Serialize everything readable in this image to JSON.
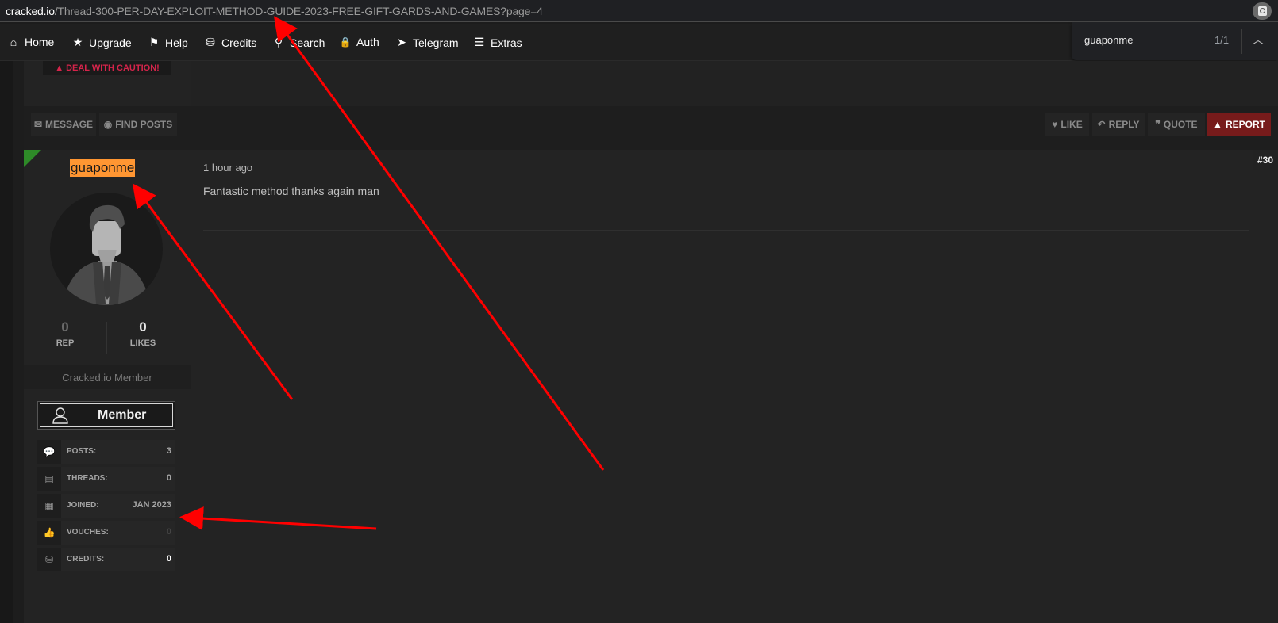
{
  "browser": {
    "url_host": "cracked.io",
    "url_path": "/Thread-300-PER-DAY-EXPLOIT-METHOD-GUIDE-2023-FREE-GIFT-GARDS-AND-GAMES?page=4",
    "lens_icon": "google-lens-icon"
  },
  "find_bar": {
    "query": "guaponme",
    "match_count": "1/1",
    "prev_icon": "chevron-up-icon"
  },
  "nav": {
    "items": [
      {
        "label": "Home",
        "icon": "home-icon",
        "glyph": "⌂"
      },
      {
        "label": "Upgrade",
        "icon": "star-icon",
        "glyph": "★"
      },
      {
        "label": "Help",
        "icon": "flag-icon",
        "glyph": "⚑"
      },
      {
        "label": "Credits",
        "icon": "coins-icon",
        "glyph": "⛁"
      },
      {
        "label": "Search",
        "icon": "search-icon",
        "glyph": "⚲"
      },
      {
        "label": "Auth",
        "icon": "lock-icon",
        "glyph": "🔒"
      },
      {
        "label": "Telegram",
        "icon": "telegram-icon",
        "glyph": "➤"
      },
      {
        "label": "Extras",
        "icon": "bars-icon",
        "glyph": "☰"
      }
    ]
  },
  "prev_post": {
    "caution_label": "DEAL WITH CAUTION!",
    "caution_color": "#d6244b"
  },
  "actions": {
    "message": "MESSAGE",
    "find_posts": "FIND POSTS",
    "like": "LIKE",
    "reply": "REPLY",
    "quote": "QUOTE",
    "report": "REPORT",
    "report_color": "#771b1b"
  },
  "post": {
    "username": "guaponme",
    "username_highlight": "#ff9632",
    "online_color": "#2e8a28",
    "rep_value": "0",
    "rep_label": "REP",
    "likes_value": "0",
    "likes_label": "LIKES",
    "usergroup": "Cracked.io Member",
    "badge_label": "Member",
    "info": [
      {
        "key": "POSTS:",
        "value": "3",
        "icon": "comments-icon",
        "glyph": "💬"
      },
      {
        "key": "THREADS:",
        "value": "0",
        "icon": "book-icon",
        "glyph": "▤"
      },
      {
        "key": "JOINED:",
        "value": "JAN 2023",
        "icon": "calendar-icon",
        "glyph": "▦"
      },
      {
        "key": "VOUCHES:",
        "value": "0",
        "icon": "thumbs-up-icon",
        "glyph": "👍"
      },
      {
        "key": "CREDITS:",
        "value": "0",
        "icon": "coins-icon",
        "glyph": "⛁"
      }
    ],
    "date": "1 hour ago",
    "number": "#30",
    "message": "Fantastic method thanks again man"
  },
  "annotation_color": "#ff0000"
}
